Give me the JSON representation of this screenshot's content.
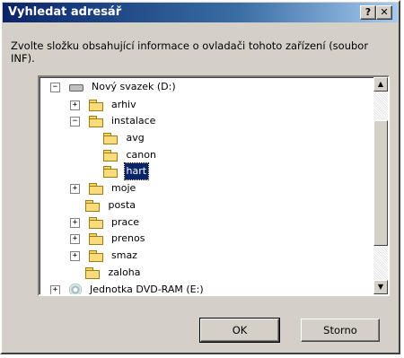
{
  "window": {
    "title": "Vyhledat adresář",
    "help_label": "?",
    "close_label": "✕"
  },
  "description": "Zvolte složku obsahující informace o ovladači tohoto zařízení (soubor INF).",
  "tree": [
    {
      "label": "Nový svazek (D:)",
      "icon": "hard-drive-icon",
      "expander": "−",
      "selected": false
    },
    {
      "label": "arhiv",
      "icon": "folder-icon",
      "expander": "+",
      "selected": false
    },
    {
      "label": "instalace",
      "icon": "folder-open-icon",
      "expander": "−",
      "selected": false
    },
    {
      "label": "avg",
      "icon": "folder-icon",
      "expander": "",
      "selected": false
    },
    {
      "label": "canon",
      "icon": "folder-icon",
      "expander": "",
      "selected": false
    },
    {
      "label": "hart",
      "icon": "folder-open-icon",
      "expander": "",
      "selected": true
    },
    {
      "label": "moje",
      "icon": "folder-icon",
      "expander": "+",
      "selected": false
    },
    {
      "label": "posta",
      "icon": "folder-icon",
      "expander": "",
      "selected": false
    },
    {
      "label": "prace",
      "icon": "folder-icon",
      "expander": "+",
      "selected": false
    },
    {
      "label": "prenos",
      "icon": "shared-folder-icon",
      "expander": "+",
      "selected": false
    },
    {
      "label": "smaz",
      "icon": "folder-icon",
      "expander": "+",
      "selected": false
    },
    {
      "label": "zaloha",
      "icon": "folder-icon",
      "expander": "",
      "selected": false
    },
    {
      "label": "Jednotka DVD-RAM (E:)",
      "icon": "dvd-drive-icon",
      "expander": "+",
      "selected": false
    }
  ],
  "scrollbar": {
    "up_glyph": "▲",
    "down_glyph": "▼"
  },
  "buttons": {
    "ok": "OK",
    "cancel": "Storno"
  },
  "colors": {
    "titlebar": "#0a246a",
    "dialog_bg": "#d4d0c8",
    "selection": "#0a246a"
  }
}
